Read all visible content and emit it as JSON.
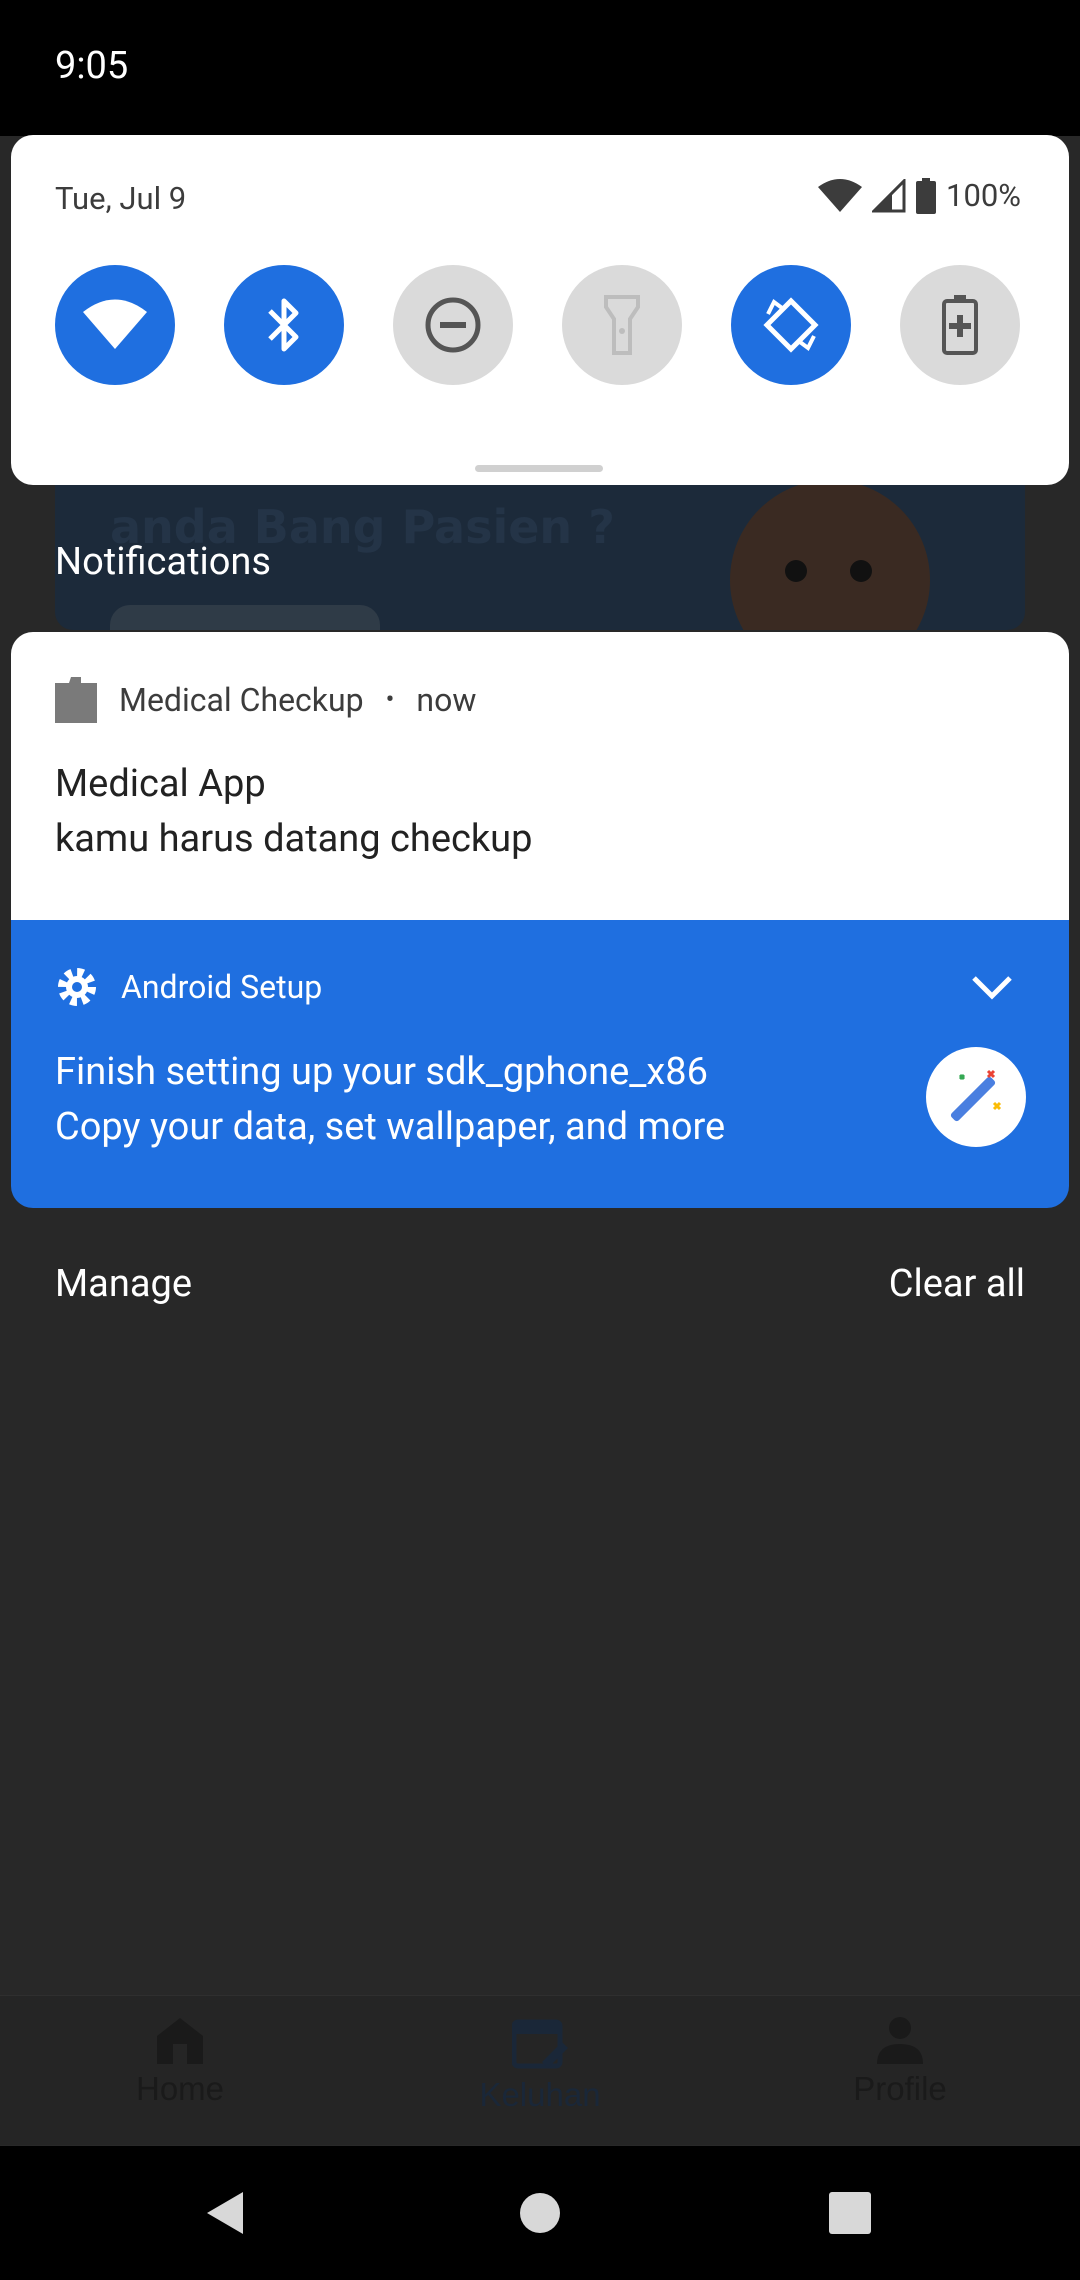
{
  "status_bar": {
    "time": "9:05"
  },
  "quick_settings": {
    "date": "Tue, Jul 9",
    "battery": "100%",
    "tiles": [
      {
        "name": "wifi",
        "icon": "wifi-icon",
        "state": "on"
      },
      {
        "name": "bluetooth",
        "icon": "bluetooth-icon",
        "state": "on"
      },
      {
        "name": "do-not-disturb",
        "icon": "dnd-icon",
        "state": "off"
      },
      {
        "name": "flashlight",
        "icon": "flashlight-icon",
        "state": "off"
      },
      {
        "name": "auto-rotate",
        "icon": "rotate-icon",
        "state": "on"
      },
      {
        "name": "battery-saver",
        "icon": "battery-saver-icon",
        "state": "off"
      }
    ]
  },
  "background_app": {
    "banner_text": "anda Bang Pasien ?",
    "bottom_nav": [
      {
        "label": "Home",
        "icon": "home-icon"
      },
      {
        "label": "Keluhan",
        "icon": "calendar-edit-icon",
        "active": true
      },
      {
        "label": "Profile",
        "icon": "person-icon"
      }
    ]
  },
  "notifications": {
    "header": "Notifications",
    "items": [
      {
        "app": "Medical Checkup",
        "time": "now",
        "title": "Medical App",
        "text": "kamu harus datang checkup"
      },
      {
        "app": "Android Setup",
        "title": "Finish setting up your sdk_gphone_x86",
        "text": "Copy your data, set wallpaper, and more"
      }
    ],
    "manage_label": "Manage",
    "clear_all_label": "Clear all"
  },
  "colors": {
    "accent": "#1F6FE0",
    "panel": "#FFFFFF",
    "scrim": "#282828"
  }
}
